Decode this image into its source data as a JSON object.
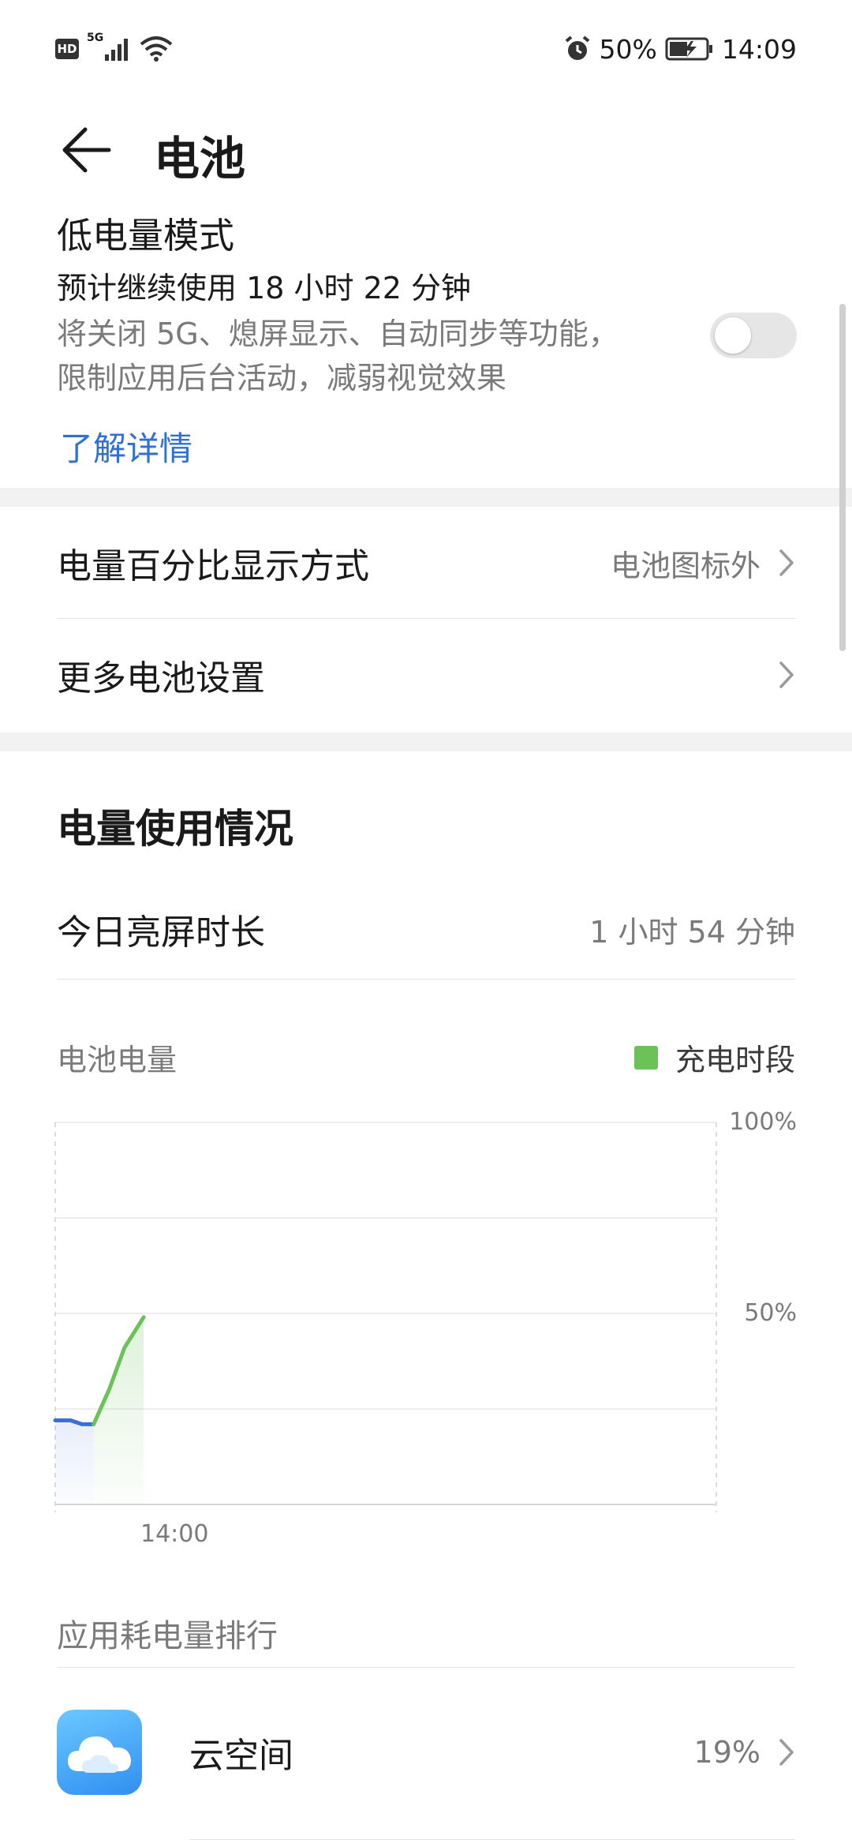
{
  "status_bar": {
    "hd": "HD",
    "network": "5G",
    "battery_percent": "50%",
    "time": "14:09"
  },
  "header": {
    "title": "电池"
  },
  "low_power": {
    "title": "低电量模式",
    "estimate": "预计继续使用 18 小时 22 分钟",
    "description_line1": "将关闭 5G、熄屏显示、自动同步等功能，",
    "description_line2": "限制应用后台活动，减弱视觉效果",
    "link": "了解详情",
    "enabled": false
  },
  "settings": {
    "percent_display": {
      "label": "电量百分比显示方式",
      "value": "电池图标外"
    },
    "more": {
      "label": "更多电池设置"
    }
  },
  "usage": {
    "title": "电量使用情况",
    "screen_time_label": "今日亮屏时长",
    "screen_time_value": "1 小时 54 分钟",
    "chart_label": "电池电量",
    "legend_charging": "充电时段"
  },
  "chart_data": {
    "type": "line",
    "y_ticks": [
      "100%",
      "50%"
    ],
    "x_ticks": [
      "14:00"
    ],
    "ylim": [
      0,
      100
    ],
    "series": [
      {
        "segment": "discharging",
        "color": "#3a6fd8",
        "points": [
          [
            0,
            22
          ],
          [
            2,
            22
          ],
          [
            3.5,
            21
          ],
          [
            5,
            21
          ]
        ]
      },
      {
        "segment": "charging",
        "color": "#6ac259",
        "points": [
          [
            5,
            21
          ],
          [
            7,
            30
          ],
          [
            9,
            41
          ],
          [
            11.5,
            49
          ]
        ]
      }
    ],
    "x_range": [
      0,
      86
    ]
  },
  "ranking": {
    "title": "应用耗电量排行",
    "apps": [
      {
        "name": "云空间",
        "percent": "19%"
      }
    ]
  }
}
